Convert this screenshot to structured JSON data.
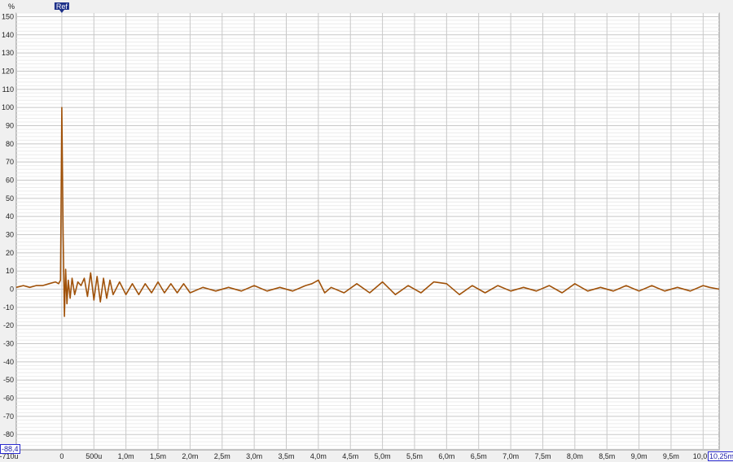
{
  "chart_data": {
    "type": "line",
    "title": "",
    "xlabel": "",
    "ylabel": "%",
    "ylim": [
      -88.4,
      152
    ],
    "xlim_ms": [
      -0.71,
      10.25
    ],
    "grid": true,
    "line_color": "#a0520a",
    "y_ticks": [
      "150",
      "140",
      "130",
      "120",
      "110",
      "100",
      "90",
      "80",
      "70",
      "60",
      "50",
      "40",
      "30",
      "20",
      "10",
      "0",
      "-10",
      "-20",
      "-30",
      "-40",
      "-50",
      "-60",
      "-70",
      "-80"
    ],
    "x_ticks": [
      {
        "label": "-710u",
        "ms": -0.71
      },
      {
        "label": "0",
        "ms": 0
      },
      {
        "label": "500u",
        "ms": 0.5
      },
      {
        "label": "1,0m",
        "ms": 1.0
      },
      {
        "label": "1,5m",
        "ms": 1.5
      },
      {
        "label": "2,0m",
        "ms": 2.0
      },
      {
        "label": "2,5m",
        "ms": 2.5
      },
      {
        "label": "3,0m",
        "ms": 3.0
      },
      {
        "label": "3,5m",
        "ms": 3.5
      },
      {
        "label": "4,0m",
        "ms": 4.0
      },
      {
        "label": "4,5m",
        "ms": 4.5
      },
      {
        "label": "5,0m",
        "ms": 5.0
      },
      {
        "label": "5,5m",
        "ms": 5.5
      },
      {
        "label": "6,0m",
        "ms": 6.0
      },
      {
        "label": "6,5m",
        "ms": 6.5
      },
      {
        "label": "7,0m",
        "ms": 7.0
      },
      {
        "label": "7,5m",
        "ms": 7.5
      },
      {
        "label": "8,0m",
        "ms": 8.0
      },
      {
        "label": "8,5m",
        "ms": 8.5
      },
      {
        "label": "9,0m",
        "ms": 9.0
      },
      {
        "label": "9,5m",
        "ms": 9.5
      },
      {
        "label": "10,0m",
        "ms": 10.0
      }
    ],
    "x_end_label": "10,25m",
    "y_bottom_label": "-88,4",
    "ref_marker": {
      "label": "Ref",
      "ms": 0
    },
    "series": [
      {
        "x": [
          -0.71,
          -0.6,
          -0.5,
          -0.4,
          -0.3,
          -0.2,
          -0.1,
          -0.05,
          -0.02,
          0,
          0.02,
          0.04,
          0.06,
          0.08,
          0.1,
          0.13,
          0.16,
          0.2,
          0.25,
          0.3,
          0.35,
          0.4,
          0.45,
          0.5,
          0.55,
          0.6,
          0.65,
          0.7,
          0.75,
          0.8,
          0.9,
          1.0,
          1.1,
          1.2,
          1.3,
          1.4,
          1.5,
          1.6,
          1.7,
          1.8,
          1.9,
          2.0,
          2.2,
          2.4,
          2.6,
          2.8,
          3.0,
          3.2,
          3.4,
          3.6,
          3.8,
          3.9,
          4.0,
          4.1,
          4.2,
          4.4,
          4.6,
          4.8,
          5.0,
          5.2,
          5.4,
          5.6,
          5.8,
          6.0,
          6.2,
          6.4,
          6.6,
          6.8,
          7.0,
          7.2,
          7.4,
          7.6,
          7.8,
          8.0,
          8.2,
          8.4,
          8.6,
          8.8,
          9.0,
          9.2,
          9.4,
          9.6,
          9.8,
          10.0,
          10.1,
          10.25
        ],
        "y": [
          1,
          2,
          1,
          2,
          2,
          3,
          4,
          3,
          5,
          100,
          30,
          -15,
          11,
          -8,
          5,
          -5,
          6,
          -3,
          4,
          2,
          6,
          -4,
          9,
          -6,
          7,
          -7,
          6,
          -5,
          5,
          -3,
          4,
          -3,
          3,
          -3,
          3,
          -2,
          4,
          -2,
          3,
          -2,
          3,
          -2,
          1,
          -1,
          1,
          -1,
          2,
          -1,
          1,
          -1,
          2,
          3,
          5,
          -2,
          1,
          -2,
          3,
          -2,
          4,
          -3,
          2,
          -2,
          4,
          3,
          -3,
          2,
          -2,
          2,
          -1,
          1,
          -1,
          2,
          -2,
          3,
          -1,
          1,
          -1,
          2,
          -1,
          2,
          -1,
          1,
          -1,
          2,
          1,
          0
        ]
      }
    ]
  }
}
